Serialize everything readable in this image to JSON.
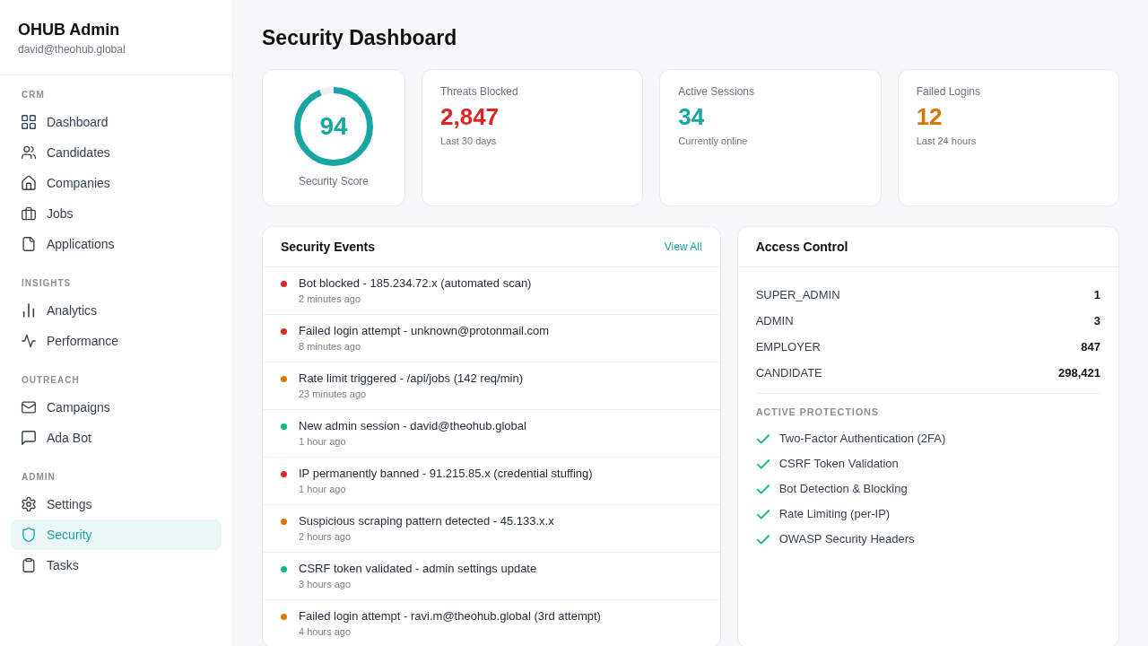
{
  "sidebar": {
    "title": "OHUB Admin",
    "email": "david@theohub.global",
    "sections": [
      {
        "label": "CRM",
        "items": [
          {
            "label": "Dashboard",
            "selected": false
          },
          {
            "label": "Candidates",
            "selected": false
          },
          {
            "label": "Companies",
            "selected": false
          },
          {
            "label": "Jobs",
            "selected": false
          },
          {
            "label": "Applications",
            "selected": false
          }
        ]
      },
      {
        "label": "INSIGHTS",
        "items": [
          {
            "label": "Analytics",
            "selected": false
          },
          {
            "label": "Performance",
            "selected": false
          }
        ]
      },
      {
        "label": "OUTREACH",
        "items": [
          {
            "label": "Campaigns",
            "selected": false
          },
          {
            "label": "Ada Bot",
            "selected": false
          }
        ]
      },
      {
        "label": "ADMIN",
        "items": [
          {
            "label": "Settings",
            "selected": false
          },
          {
            "label": "Security",
            "selected": true
          },
          {
            "label": "Tasks",
            "selected": false
          }
        ]
      }
    ]
  },
  "page_title": "Security Dashboard",
  "score": {
    "value": "94",
    "label": "Security Score",
    "level": 0.94
  },
  "stats": [
    {
      "label": "Threats Blocked",
      "value": "2,847",
      "note": "Last 30 days",
      "color": "#dc2626"
    },
    {
      "label": "Active Sessions",
      "value": "34",
      "note": "Currently online",
      "color": "#17a6a2"
    },
    {
      "label": "Failed Logins",
      "value": "12",
      "note": "Last 24 hours",
      "color": "#d97706"
    }
  ],
  "events": {
    "title": "Security Events",
    "link": "View All",
    "items": [
      {
        "text": "Bot blocked - 185.234.72.x (automated scan)",
        "time": "2 minutes ago",
        "color": "#dc2626"
      },
      {
        "text": "Failed login attempt - unknown@protonmail.com",
        "time": "8 minutes ago",
        "color": "#dc2626"
      },
      {
        "text": "Rate limit triggered - /api/jobs (142 req/min)",
        "time": "23 minutes ago",
        "color": "#d97706"
      },
      {
        "text": "New admin session - david@theohub.global",
        "time": "1 hour ago",
        "color": "#10b981"
      },
      {
        "text": "IP permanently banned - 91.215.85.x (credential stuffing)",
        "time": "1 hour ago",
        "color": "#dc2626"
      },
      {
        "text": "Suspicious scraping pattern detected - 45.133.x.x",
        "time": "2 hours ago",
        "color": "#d97706"
      },
      {
        "text": "CSRF token validated - admin settings update",
        "time": "3 hours ago",
        "color": "#10b981"
      },
      {
        "text": "Failed login attempt - ravi.m@theohub.global (3rd attempt)",
        "time": "4 hours ago",
        "color": "#d97706"
      }
    ]
  },
  "access_control": {
    "title": "Access Control",
    "roles": [
      {
        "name": "SUPER_ADMIN",
        "count": "1"
      },
      {
        "name": "ADMIN",
        "count": "3"
      },
      {
        "name": "EMPLOYER",
        "count": "847"
      },
      {
        "name": "CANDIDATE",
        "count": "298,421"
      }
    ],
    "protections_title": "ACTIVE PROTECTIONS",
    "protections": [
      {
        "label": "Two-Factor Authentication (2FA)"
      },
      {
        "label": "CSRF Token Validation"
      },
      {
        "label": "Bot Detection & Blocking"
      },
      {
        "label": "Rate Limiting (per-IP)"
      },
      {
        "label": "OWASP Security Headers"
      }
    ]
  }
}
